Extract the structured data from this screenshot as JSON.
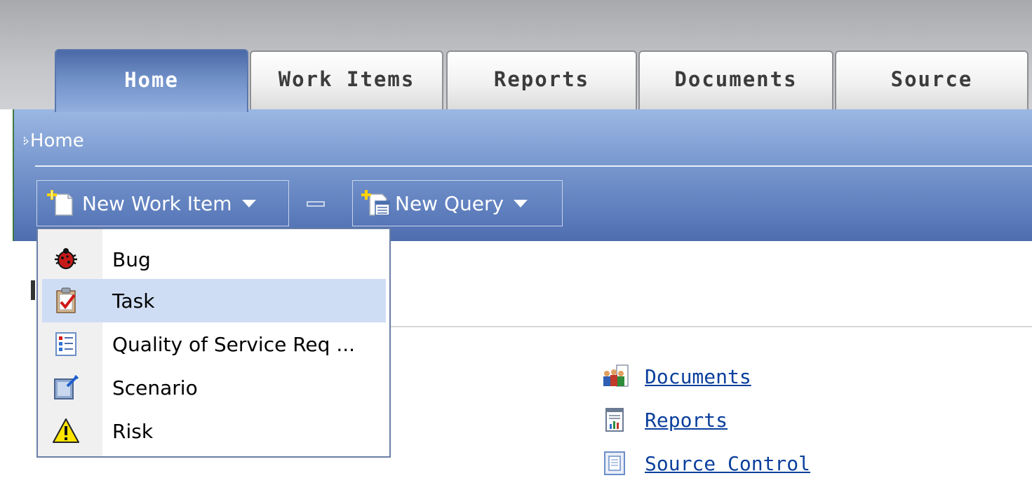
{
  "tabs": [
    {
      "label": "Home",
      "active": true
    },
    {
      "label": "Work Items",
      "active": false
    },
    {
      "label": "Reports",
      "active": false
    },
    {
      "label": "Documents",
      "active": false
    },
    {
      "label": "Source",
      "active": false
    }
  ],
  "breadcrumb": {
    "label": "Home"
  },
  "toolbar": {
    "new_work_item_label": "New Work Item",
    "new_query_label": "New Query"
  },
  "menu": {
    "items": [
      {
        "label": "Bug",
        "icon": "bug-icon"
      },
      {
        "label": "Task",
        "icon": "task-icon",
        "highlighted": true
      },
      {
        "label": "Quality of Service Req ...",
        "icon": "requirement-icon"
      },
      {
        "label": "Scenario",
        "icon": "scenario-icon"
      },
      {
        "label": "Risk",
        "icon": "risk-warning-icon"
      }
    ]
  },
  "quick_links": [
    {
      "label": "Documents",
      "icon": "documents-people-icon"
    },
    {
      "label": "Reports",
      "icon": "report-icon"
    },
    {
      "label": "Source Control",
      "icon": "source-control-icon"
    }
  ],
  "colors": {
    "active_tab": "#5b77ad",
    "toolbar_blue": "#6f8fc7",
    "menu_highlight": "#cfddf4",
    "link": "#0a3f9c"
  }
}
